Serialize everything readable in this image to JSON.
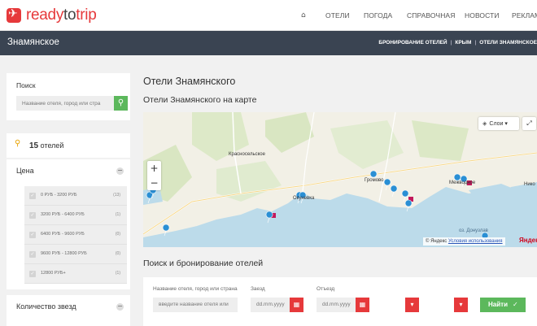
{
  "brand": {
    "part1": "ready",
    "part2": "to",
    "part3": "trip"
  },
  "nav": {
    "home_icon": "home-icon",
    "items": [
      "ОТЕЛИ",
      "ПОГОДА",
      "СПРАВОЧНАЯ",
      "НОВОСТИ",
      "РЕКЛАМА"
    ]
  },
  "titlebar": {
    "title": "Знамянское",
    "breadcrumbs": [
      "БРОНИРОВАНИЕ ОТЕЛЕЙ",
      "КРЫМ",
      "ОТЕЛИ ЗНАМЯНСКОЕ"
    ]
  },
  "sidebar": {
    "search": {
      "label": "Поиск",
      "placeholder": "Название отеля, город или стра",
      "button_icon": "search-icon"
    },
    "count": {
      "number": "15",
      "label": "отелей"
    },
    "price": {
      "title": "Цена",
      "items": [
        {
          "label": "0 РУБ - 3200 РУБ",
          "count": "(13)"
        },
        {
          "label": "3200 РУБ - 6400 РУБ",
          "count": "(1)"
        },
        {
          "label": "6400 РУБ - 9600 РУБ",
          "count": "(0)"
        },
        {
          "label": "9600 РУБ - 12800 РУБ",
          "count": "(0)"
        },
        {
          "label": "12800 РУБ+",
          "count": "(1)"
        }
      ]
    },
    "stars": {
      "title": "Количество звезд"
    }
  },
  "main": {
    "heading": "Отели Знамянского",
    "map_heading": "Отели Знамянского на карте",
    "map": {
      "labels": [
        "Красносельское",
        "Окуневка",
        "Громово",
        "Межводное",
        "Нико",
        "оз. Донузлав"
      ],
      "layers_label": "Слои",
      "copyright": "© Яндекс",
      "terms": "Условия использования",
      "provider": "Яндекс",
      "zoom_in": "+",
      "zoom_out": "−"
    },
    "booking_heading": "Поиск и бронирование отелей",
    "booking": {
      "name_label": "Название отеля, город или страна",
      "name_placeholder": "введите название отеля или",
      "checkin_label": "Заезд",
      "checkin_placeholder": "dd.mm.yyyy",
      "checkout_label": "Отъезд",
      "checkout_placeholder": "dd.mm.yyyy",
      "submit_label": "Найти"
    }
  },
  "colors": {
    "brand_red": "#e6393b",
    "accent_green": "#5cb85c",
    "title_bar": "#3a4452",
    "map_water": "#bcdbea",
    "map_land": "#f2f0e6",
    "pin_blue": "#2a8fd4"
  }
}
